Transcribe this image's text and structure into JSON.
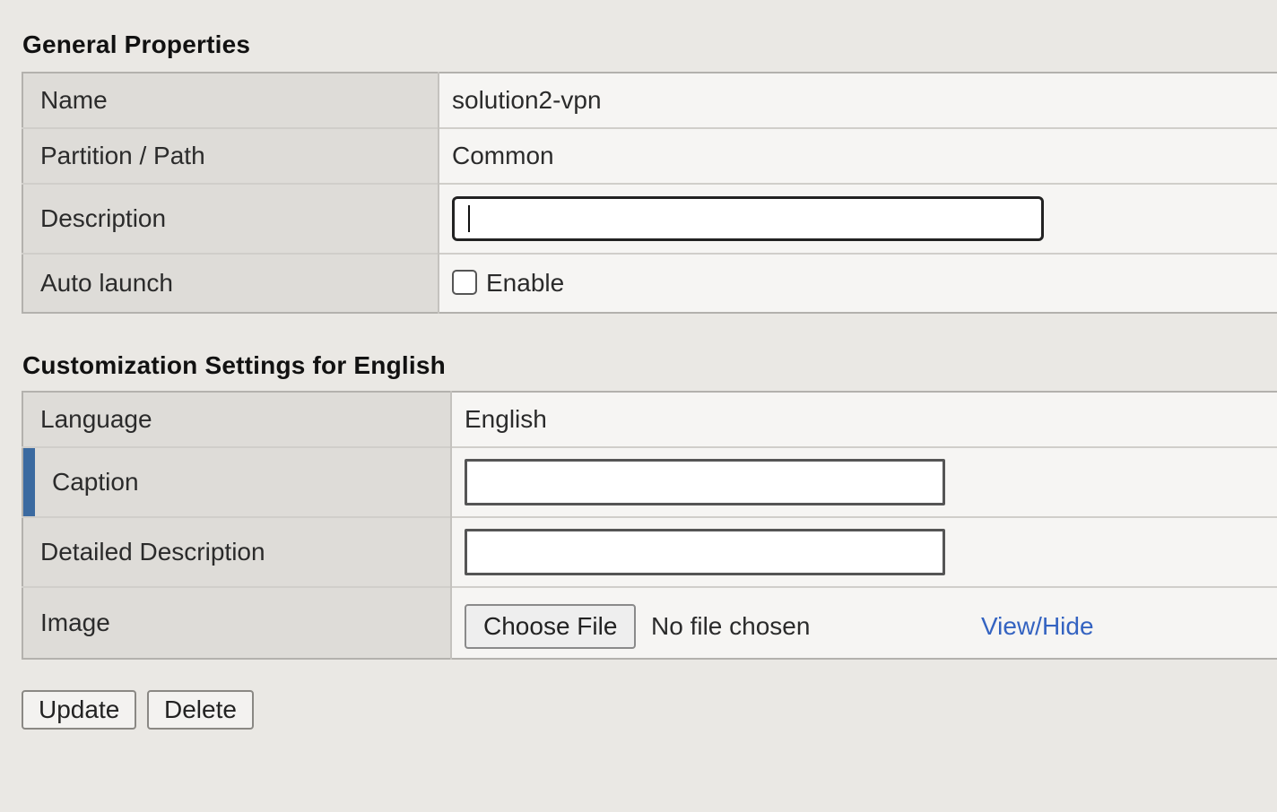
{
  "general": {
    "title": "General Properties",
    "rows": {
      "name": {
        "label": "Name",
        "value": "solution2-vpn"
      },
      "partition": {
        "label": "Partition / Path",
        "value": "Common"
      },
      "description": {
        "label": "Description",
        "value": ""
      },
      "auto_launch": {
        "label": "Auto launch",
        "checkbox_label": "Enable",
        "checked": false
      }
    }
  },
  "customization": {
    "title": "Customization Settings for English",
    "rows": {
      "language": {
        "label": "Language",
        "value": "English"
      },
      "caption": {
        "label": "Caption",
        "value": "",
        "required": true
      },
      "detailed_description": {
        "label": "Detailed Description",
        "value": ""
      },
      "image": {
        "label": "Image",
        "choose_button": "Choose File",
        "file_status": "No file chosen",
        "view_link": "View/Hide"
      }
    }
  },
  "actions": {
    "update": "Update",
    "delete": "Delete"
  },
  "colors": {
    "page_background": "#eae8e4",
    "label_background": "#dedcd8",
    "value_background": "#f6f5f3",
    "required_marker": "#3b6aa0",
    "link": "#3463c1"
  }
}
